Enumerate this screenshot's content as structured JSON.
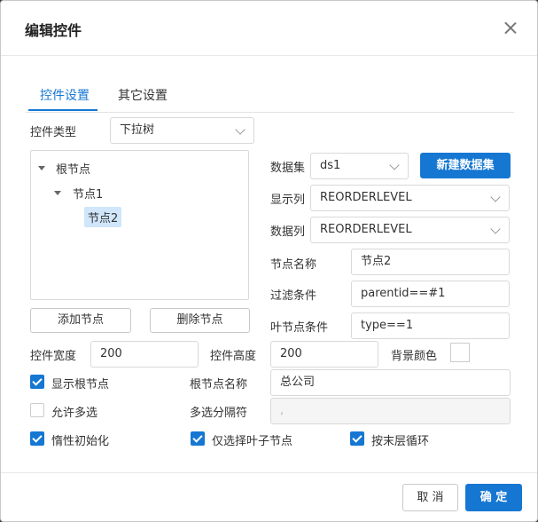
{
  "dialog": {
    "title": "编辑控件"
  },
  "tabs": [
    {
      "label": "控件设置",
      "active": true
    },
    {
      "label": "其它设置",
      "active": false
    }
  ],
  "control_type": {
    "label": "控件类型",
    "value": "下拉树"
  },
  "tree": {
    "root": "根节点",
    "child": "节点1",
    "grandchild": "节点2"
  },
  "tree_buttons": {
    "add": "添加节点",
    "delete": "删除节点"
  },
  "dataset": {
    "label": "数据集",
    "value": "ds1",
    "new_button": "新建数据集"
  },
  "display_col": {
    "label": "显示列",
    "value": "REORDERLEVEL"
  },
  "data_col": {
    "label": "数据列",
    "value": "REORDERLEVEL"
  },
  "node_name": {
    "label": "节点名称",
    "value": "节点2"
  },
  "filter": {
    "label": "过滤条件",
    "value": "parentid==#1"
  },
  "leaf_cond": {
    "label": "叶节点条件",
    "value": "type==1"
  },
  "width": {
    "label": "控件宽度",
    "value": "200"
  },
  "height": {
    "label": "控件高度",
    "value": "200"
  },
  "bg_color": {
    "label": "背景颜色",
    "value": "#ffffff"
  },
  "show_root": {
    "label": "显示根节点",
    "checked": true
  },
  "root_name": {
    "label": "根节点名称",
    "value": "总公司"
  },
  "multi": {
    "label": "允许多选",
    "checked": false
  },
  "separator": {
    "label": "多选分隔符",
    "value": ","
  },
  "lazy": {
    "label": "惰性初始化",
    "checked": true
  },
  "leaf_only": {
    "label": "仅选择叶子节点",
    "checked": true
  },
  "last_loop": {
    "label": "按末层循环",
    "checked": true
  },
  "footer": {
    "cancel": "取 消",
    "ok": "确 定"
  },
  "colors": {
    "accent": "#1677d2",
    "border": "#d9d9d9",
    "selected_bg": "#cfe6fb"
  }
}
